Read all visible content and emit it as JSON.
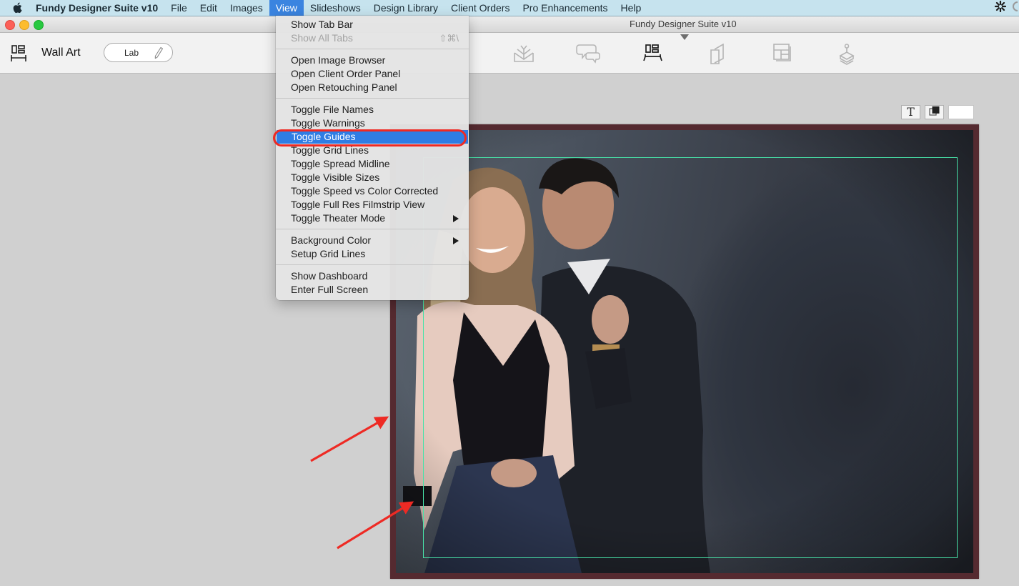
{
  "menubar": {
    "app_name": "Fundy Designer Suite v10",
    "items": [
      "File",
      "Edit",
      "Images",
      "View",
      "Slideshows",
      "Design Library",
      "Client Orders",
      "Pro Enhancements",
      "Help"
    ],
    "active_item": "View",
    "status_icons": [
      "sync-gear-icon",
      "status-circle-icon"
    ]
  },
  "window": {
    "title": "Fundy Designer Suite v10"
  },
  "toolbar": {
    "product_icon": "wall-art-icon",
    "product_label": "Wall Art",
    "lab_button_label": "Lab",
    "lab_edit_icon": "pencil-icon",
    "modes": [
      {
        "name": "album-icon",
        "active": false
      },
      {
        "name": "proofing-chat-icon",
        "active": false
      },
      {
        "name": "wall-art-icon",
        "active": true
      },
      {
        "name": "cards-icon",
        "active": false
      },
      {
        "name": "layout-templates-icon",
        "active": false
      },
      {
        "name": "stamp-icon",
        "active": false
      }
    ]
  },
  "canvas": {
    "tools": [
      {
        "name": "text-tool",
        "label": "T"
      },
      {
        "name": "arrange-layers-tool",
        "label": ""
      },
      {
        "name": "background-swatch",
        "label": ""
      }
    ],
    "frame_color": "#552a30",
    "guide_color": "#48e2a8",
    "image_description": "Couple portrait photo"
  },
  "view_menu": {
    "groups": [
      [
        {
          "label": "Show Tab Bar",
          "disabled": false
        },
        {
          "label": "Show All Tabs",
          "disabled": true,
          "shortcut": "⇧⌘\\"
        }
      ],
      [
        {
          "label": "Open Image Browser"
        },
        {
          "label": "Open Client Order Panel"
        },
        {
          "label": "Open Retouching Panel"
        }
      ],
      [
        {
          "label": "Toggle File Names"
        },
        {
          "label": "Toggle Warnings"
        },
        {
          "label": "Toggle Guides",
          "highlighted": true
        },
        {
          "label": "Toggle Grid Lines"
        },
        {
          "label": "Toggle Spread Midline"
        },
        {
          "label": "Toggle Visible Sizes"
        },
        {
          "label": "Toggle Speed vs Color Corrected"
        },
        {
          "label": "Toggle Full Res Filmstrip View"
        },
        {
          "label": "Toggle Theater Mode",
          "submenu": true
        }
      ],
      [
        {
          "label": "Background Color",
          "submenu": true
        },
        {
          "label": "Setup Grid Lines"
        }
      ],
      [
        {
          "label": "Show Dashboard"
        },
        {
          "label": "Enter Full Screen"
        }
      ]
    ]
  },
  "annotations": {
    "highlight_color": "#ee2a24",
    "arrows": 2
  }
}
